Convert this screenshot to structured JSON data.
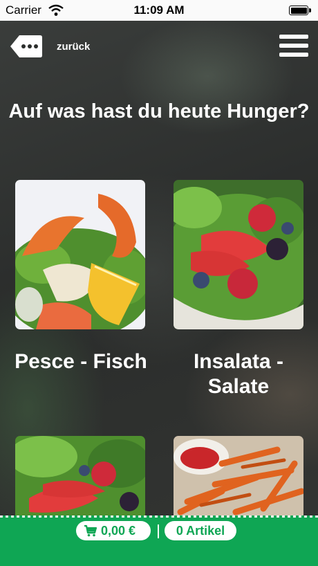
{
  "status_bar": {
    "carrier": "Carrier",
    "time": "11:09 AM"
  },
  "nav": {
    "back_label": "zurück",
    "back_icon": "more-dots-icon",
    "menu_icon": "hamburger-menu-icon"
  },
  "page": {
    "headline": "Auf was hast du heute Hunger?"
  },
  "categories": [
    {
      "label": "Pesce - Fisch",
      "image": "shrimp-salad-photo"
    },
    {
      "label": "Insalata - Salate",
      "image": "berry-salad-photo"
    },
    {
      "label": "",
      "image": "strawberry-salad-photo"
    },
    {
      "label": "",
      "image": "sweet-potato-fries-photo"
    }
  ],
  "cart": {
    "total": "0,00 €",
    "items": "0 Artikel",
    "icon": "cart-icon"
  },
  "colors": {
    "accent_green": "#0fa654",
    "text": "#ffffff"
  }
}
